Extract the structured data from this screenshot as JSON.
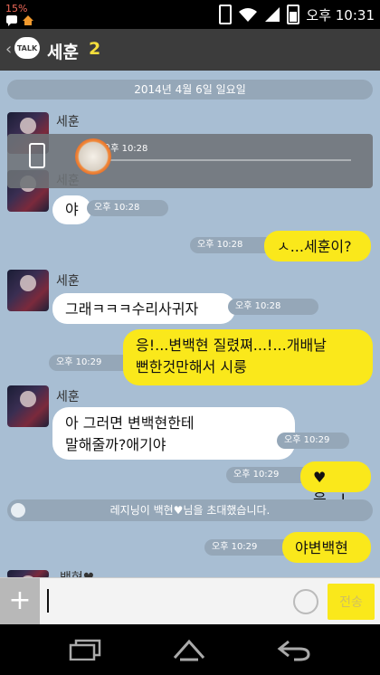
{
  "status_bar": {
    "battery_pct": "15%",
    "time": "오후 10:31"
  },
  "header": {
    "title": "세훈",
    "member_count": "2"
  },
  "date_divider": "2014년 4월 6일 일요일",
  "messages": [
    {
      "sender": "세훈",
      "text": "",
      "time": "오후 10:28"
    },
    {
      "sender": "세훈",
      "text": "야",
      "time": "오후 10:28"
    },
    {
      "text": "ㅅ...세훈이?",
      "time": "오후 10:28"
    },
    {
      "sender": "세훈",
      "text": "그래ㅋㅋㅋ수리사귀자",
      "time": "오후 10:28"
    },
    {
      "text_line1": "응!...변백현 질렸쪄...!...개배날",
      "text_line2": "뻔한것만해서 시룽",
      "time": "오후 10:29"
    },
    {
      "sender": "세훈",
      "text_line1": "아 그러면 변백현한테",
      "text_line2": "말해줄까?애기야",
      "time": "오후 10:29"
    },
    {
      "text": "♥응...!",
      "time": "오후 10:29"
    },
    {
      "text": "야변백현",
      "time": "오후 10:29"
    }
  ],
  "invite_notice": "레지닝이 백현♥님을 초대했습니다.",
  "partial_sender": "백현♥",
  "overlay": {
    "time": "오후 10:28"
  },
  "input": {
    "placeholder": "",
    "send_label": "전송"
  }
}
